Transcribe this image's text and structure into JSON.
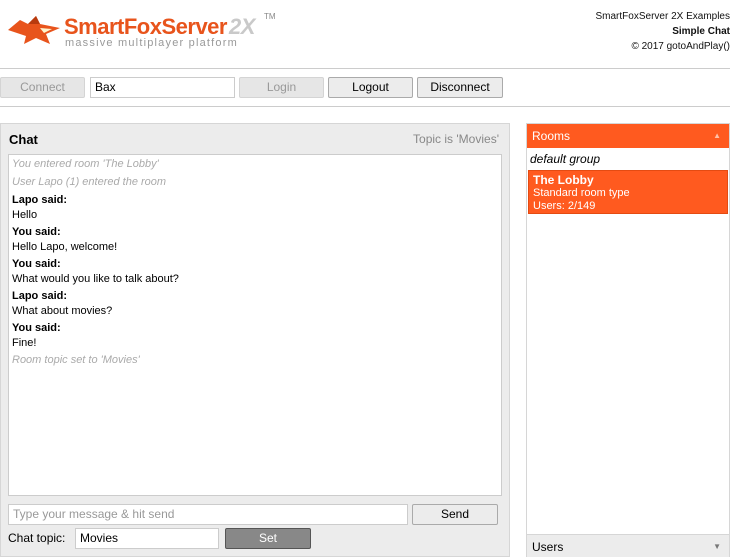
{
  "header": {
    "logo_name": "SmartFoxServer",
    "logo_suffix": "2X",
    "logo_tm": "TM",
    "logo_tagline": "massive multiplayer platform",
    "credits_line1": "SmartFoxServer 2X Examples",
    "credits_line2": "Simple Chat",
    "credits_line3": "© 2017 gotoAndPlay()"
  },
  "toolbar": {
    "connect_label": "Connect",
    "username_value": "Bax",
    "login_label": "Login",
    "logout_label": "Logout",
    "disconnect_label": "Disconnect"
  },
  "chat": {
    "title": "Chat",
    "topic_text": "Topic is 'Movies'",
    "messages": [
      {
        "type": "system",
        "text": "You entered room 'The Lobby'"
      },
      {
        "type": "system",
        "text": "User Lapo (1) entered the room"
      },
      {
        "type": "user",
        "who": "Lapo said:",
        "text": "Hello"
      },
      {
        "type": "user",
        "who": "You said:",
        "text": "Hello Lapo, welcome!"
      },
      {
        "type": "user",
        "who": "You said:",
        "text": "What would you like to talk about?"
      },
      {
        "type": "user",
        "who": "Lapo said:",
        "text": "What about movies?"
      },
      {
        "type": "user",
        "who": "You said:",
        "text": "Fine!"
      },
      {
        "type": "system",
        "text": "Room topic set to 'Movies'"
      }
    ],
    "input_placeholder": "Type your message & hit send",
    "send_label": "Send",
    "topic_label": "Chat topic:",
    "topic_value": "Movies",
    "set_label": "Set"
  },
  "rooms": {
    "header": "Rooms",
    "group": "default group",
    "items": [
      {
        "name": "The Lobby",
        "type": "Standard room type",
        "users": "Users: 2/149"
      }
    ],
    "users_header": "Users"
  },
  "colors": {
    "accent": "#ff5a1f",
    "logo_orange": "#e8541c"
  }
}
